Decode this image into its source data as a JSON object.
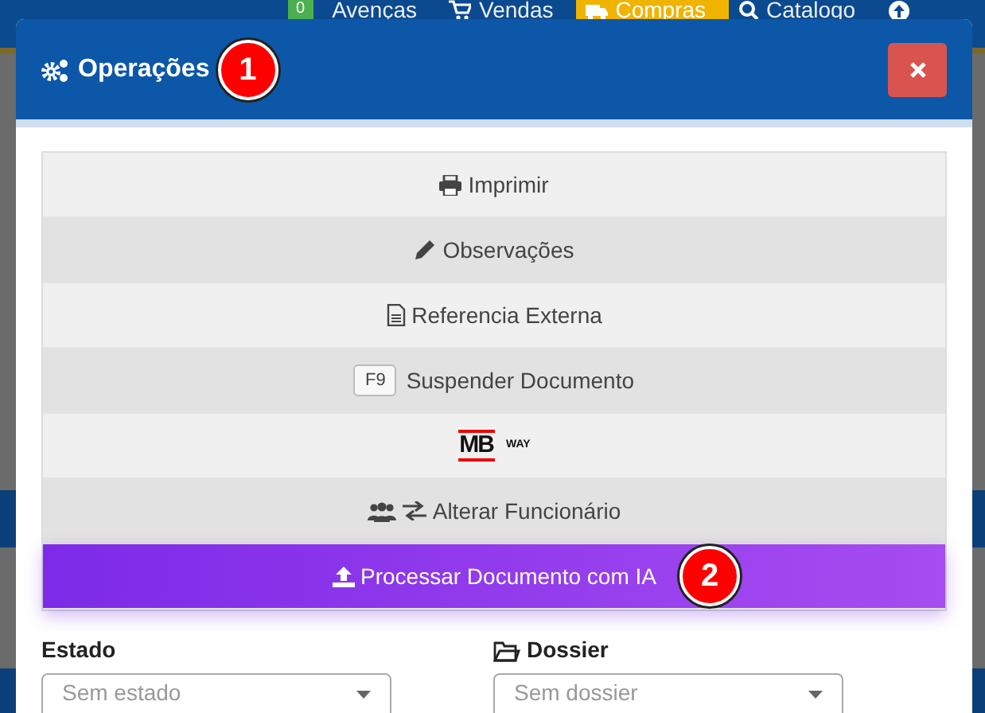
{
  "navbar": {
    "items": [
      {
        "kind": "counter",
        "badge": "0",
        "label": "Avenças",
        "selected": false
      },
      {
        "kind": "cart",
        "label": "Vendas",
        "selected": false
      },
      {
        "kind": "truck",
        "label": "Compras",
        "selected": true
      },
      {
        "kind": "search",
        "label": "Catalogo",
        "selected": false
      },
      {
        "kind": "upload",
        "selected": false
      }
    ]
  },
  "modal": {
    "title": "Operações",
    "title_marker": "1",
    "actions": [
      {
        "kind": "print",
        "label": "Imprimir"
      },
      {
        "kind": "pencil",
        "label": "Observações"
      },
      {
        "kind": "file",
        "label": "Referencia Externa"
      },
      {
        "kind": "key",
        "key": "F9",
        "label": "Suspender Documento"
      },
      {
        "kind": "mbway",
        "logo": "MB",
        "logo_suffix": "WAY"
      },
      {
        "kind": "users",
        "label": "Alterar Funcionário"
      },
      {
        "kind": "ai",
        "label": "Processar Documento com IA",
        "marker": "2"
      }
    ],
    "fields": [
      {
        "kind": "plain",
        "label": "Estado",
        "placeholder": "Sem estado"
      },
      {
        "kind": "folder",
        "label": "Dossier",
        "placeholder": "Sem dossier"
      }
    ]
  }
}
